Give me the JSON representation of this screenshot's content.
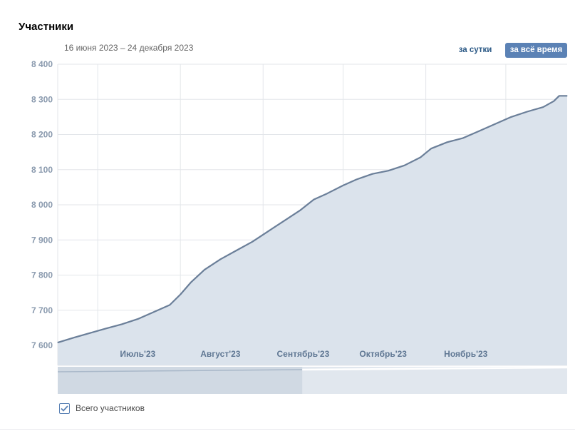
{
  "header": {
    "title": "Участники",
    "date_range": "16 июня 2023 – 24 декабря 2023",
    "buttons": {
      "per_day": "за сутки",
      "all_time": "за всё время"
    }
  },
  "legend": {
    "label": "Всего участников",
    "checked": true
  },
  "colors": {
    "line": "#6b7f99",
    "area": "#dbe3ec",
    "grid": "#e3e6ea",
    "axis_label": "#8a9aae",
    "month_label": "#5f7793",
    "button_active": "#5b82b5",
    "button_link": "#2a5885"
  },
  "chart_data": {
    "type": "area",
    "xlim": [
      "2023-06-16",
      "2023-12-24"
    ],
    "ylim": [
      7560,
      8400
    ],
    "yticks": [
      7600,
      7700,
      7800,
      7900,
      8000,
      8100,
      8200,
      8300,
      8400
    ],
    "ytick_labels": [
      "7 600",
      "7 700",
      "7 800",
      "7 900",
      "8 000",
      "8 100",
      "8 200",
      "8 300",
      "8 400"
    ],
    "month_lines": [
      "2023-07-01",
      "2023-08-01",
      "2023-09-01",
      "2023-10-01",
      "2023-11-01",
      "2023-12-01"
    ],
    "xtick_labels": [
      {
        "date": "2023-07-16",
        "label": "Июль'23"
      },
      {
        "date": "2023-08-16",
        "label": "Август'23"
      },
      {
        "date": "2023-09-16",
        "label": "Сентябрь'23"
      },
      {
        "date": "2023-10-16",
        "label": "Октябрь'23"
      },
      {
        "date": "2023-11-16",
        "label": "Ноябрь'23"
      }
    ],
    "series": [
      {
        "values": [
          {
            "x": "2023-06-16",
            "y": 7608
          },
          {
            "x": "2023-06-22",
            "y": 7622
          },
          {
            "x": "2023-06-28",
            "y": 7635
          },
          {
            "x": "2023-07-04",
            "y": 7648
          },
          {
            "x": "2023-07-10",
            "y": 7660
          },
          {
            "x": "2023-07-16",
            "y": 7675
          },
          {
            "x": "2023-07-22",
            "y": 7695
          },
          {
            "x": "2023-07-28",
            "y": 7715
          },
          {
            "x": "2023-08-01",
            "y": 7745
          },
          {
            "x": "2023-08-05",
            "y": 7780
          },
          {
            "x": "2023-08-10",
            "y": 7815
          },
          {
            "x": "2023-08-16",
            "y": 7845
          },
          {
            "x": "2023-08-22",
            "y": 7870
          },
          {
            "x": "2023-08-28",
            "y": 7895
          },
          {
            "x": "2023-09-03",
            "y": 7925
          },
          {
            "x": "2023-09-09",
            "y": 7955
          },
          {
            "x": "2023-09-15",
            "y": 7985
          },
          {
            "x": "2023-09-20",
            "y": 8015
          },
          {
            "x": "2023-09-25",
            "y": 8032
          },
          {
            "x": "2023-10-01",
            "y": 8055
          },
          {
            "x": "2023-10-06",
            "y": 8072
          },
          {
            "x": "2023-10-12",
            "y": 8088
          },
          {
            "x": "2023-10-18",
            "y": 8097
          },
          {
            "x": "2023-10-24",
            "y": 8112
          },
          {
            "x": "2023-10-30",
            "y": 8135
          },
          {
            "x": "2023-11-03",
            "y": 8160
          },
          {
            "x": "2023-11-09",
            "y": 8178
          },
          {
            "x": "2023-11-15",
            "y": 8190
          },
          {
            "x": "2023-11-21",
            "y": 8210
          },
          {
            "x": "2023-11-27",
            "y": 8230
          },
          {
            "x": "2023-12-03",
            "y": 8250
          },
          {
            "x": "2023-12-09",
            "y": 8265
          },
          {
            "x": "2023-12-15",
            "y": 8278
          },
          {
            "x": "2023-12-19",
            "y": 8295
          },
          {
            "x": "2023-12-21",
            "y": 8310
          },
          {
            "x": "2023-12-24",
            "y": 8310
          }
        ]
      }
    ],
    "navigator": {
      "selected_fraction": [
        0,
        0.48
      ]
    }
  }
}
